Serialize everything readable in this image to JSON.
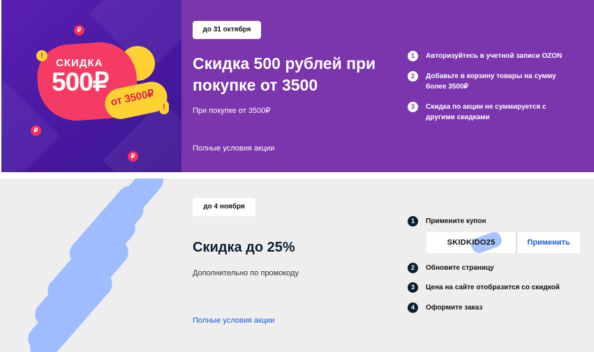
{
  "promo1": {
    "art": {
      "word": "СКИДКА",
      "amount": "500₽",
      "threshold": "от 3500₽",
      "coin_glyph": "₽",
      "exclaim_glyph": "!"
    },
    "deadline": "до 31 октября",
    "title": "Скидка 500 рублей при покупке от 3500",
    "subtitle": "При покупке от 3500₽",
    "terms_link": "Полные условия акции",
    "steps": [
      {
        "num": "1",
        "text": "Авторизуйтесь в учетной записи OZON"
      },
      {
        "num": "2",
        "text": "Добавьте в корзину товары на сумму более 3500₽"
      },
      {
        "num": "3",
        "text": "Скидка по акции не суммируется с другими скидками"
      }
    ],
    "colors": {
      "background": "#7b35ad",
      "art_background": "#4a1aa4",
      "accent_red": "#f53b64",
      "accent_yellow": "#ffd233"
    }
  },
  "promo2": {
    "deadline": "до 4 ноября",
    "title": "Скидка до 25%",
    "subtitle": "Дополнительно по промокоду",
    "terms_link": "Полные условия акции",
    "steps": [
      {
        "num": "1",
        "text": "Примените купон"
      },
      {
        "num": "2",
        "text": "Обновите страницу"
      },
      {
        "num": "3",
        "text": "Цена на сайте отобразится со скидкой"
      },
      {
        "num": "4",
        "text": "Оформите заказ"
      }
    ],
    "coupon_code": "SKIDKIDO25",
    "apply_label": "Применить",
    "colors": {
      "background": "#eeeeee",
      "art_strokes": "#9ebcff",
      "link": "#1a5bd6",
      "step_badge": "#0b1f33"
    }
  }
}
